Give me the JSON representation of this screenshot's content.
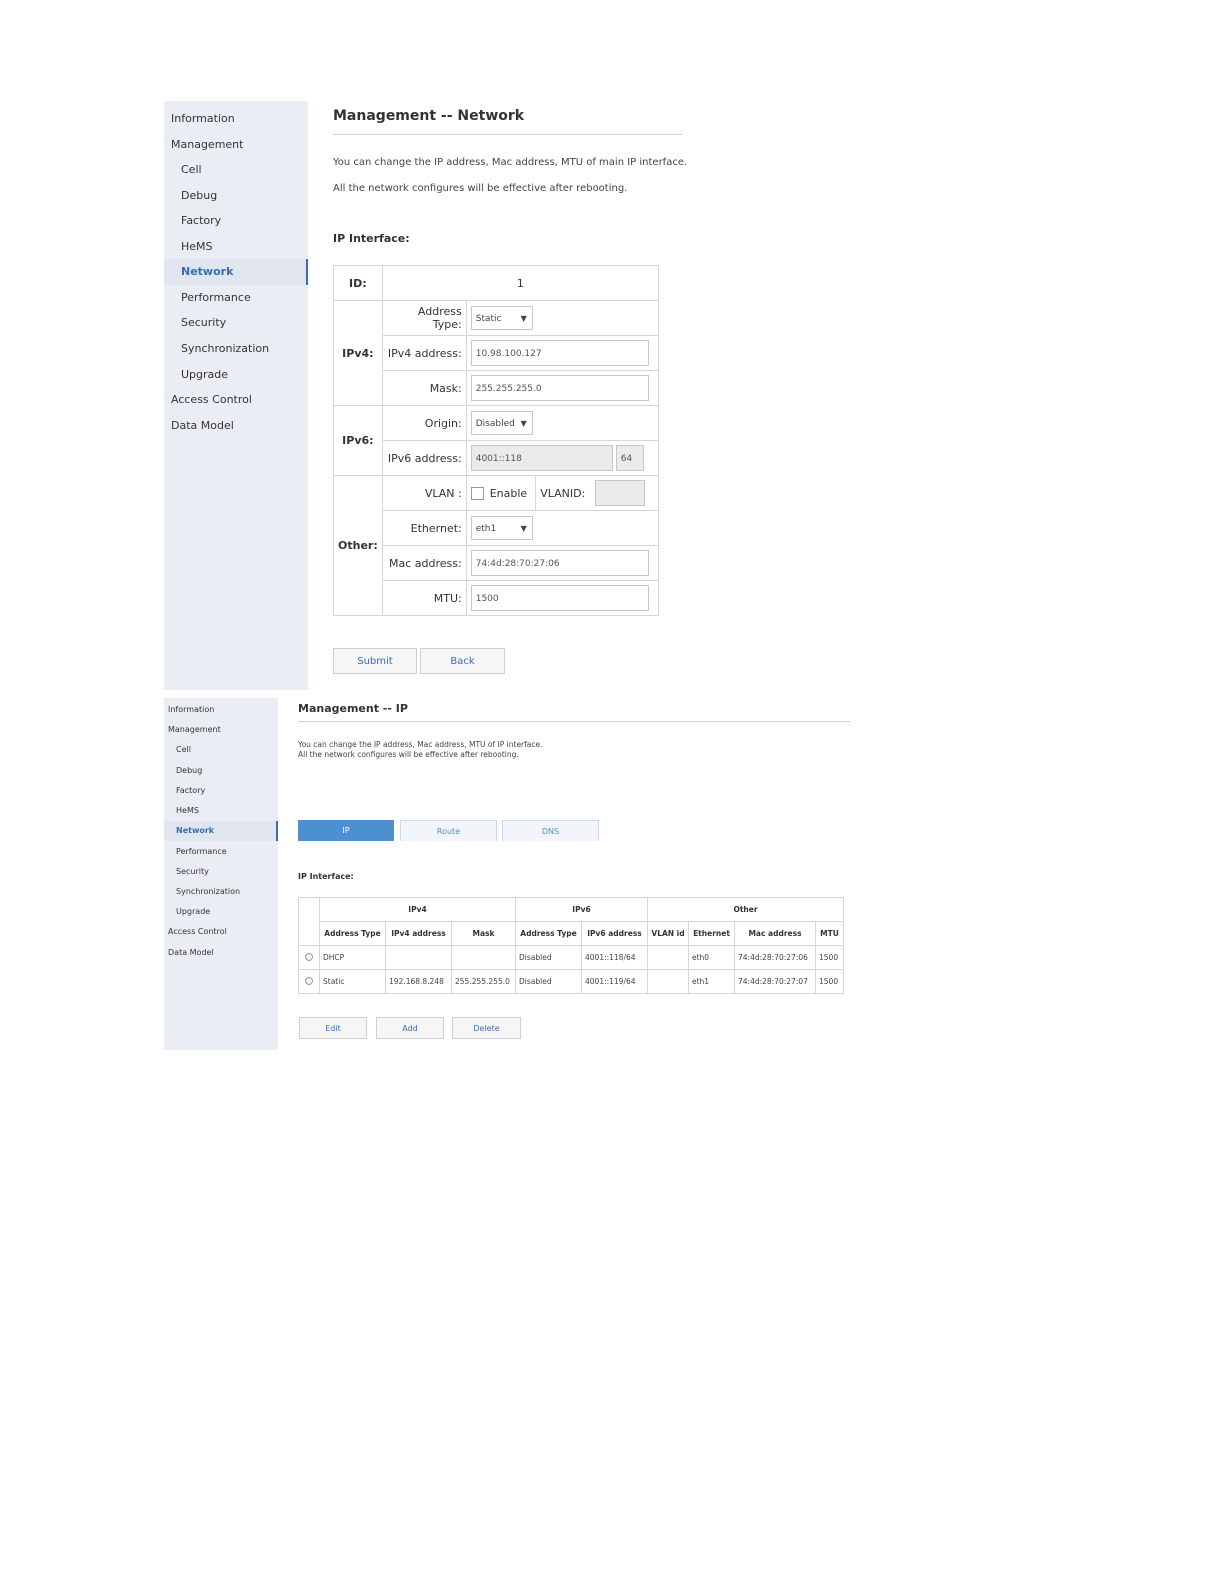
{
  "screen1": {
    "sidebar": {
      "items": [
        {
          "label": "Information"
        },
        {
          "label": "Management"
        },
        {
          "label": "Cell"
        },
        {
          "label": "Debug"
        },
        {
          "label": "Factory"
        },
        {
          "label": "HeMS"
        },
        {
          "label": "Network"
        },
        {
          "label": "Performance"
        },
        {
          "label": "Security"
        },
        {
          "label": "Synchronization"
        },
        {
          "label": "Upgrade"
        },
        {
          "label": "Access Control"
        },
        {
          "label": "Data Model"
        }
      ]
    },
    "title": "Management -- Network",
    "desc_line1": "You can change the IP address, Mac address, MTU of main IP interface.",
    "desc_line2": "All the network configures will be effective after rebooting.",
    "section_title": "IP Interface:",
    "form": {
      "id_label": "ID:",
      "id_value": "1",
      "ipv4_group": "IPv4:",
      "address_type_label": "Address Type:",
      "address_type_value": "Static",
      "ipv4_address_label": "IPv4 address:",
      "ipv4_address_value": "10.98.100.127",
      "mask_label": "Mask:",
      "mask_value": "255.255.255.0",
      "ipv6_group": "IPv6:",
      "origin_label": "Origin:",
      "origin_value": "Disabled",
      "ipv6_address_label": "IPv6 address:",
      "ipv6_address_value": "4001::118",
      "ipv6_prefix_value": "64",
      "other_group": "Other:",
      "vlan_label": "VLAN :",
      "vlan_enable_label": "Enable",
      "vlanid_label": "VLANID:",
      "vlanid_value": "",
      "ethernet_label": "Ethernet:",
      "ethernet_value": "eth1",
      "mac_label": "Mac address:",
      "mac_value": "74:4d:28:70:27:06",
      "mtu_label": "MTU:",
      "mtu_value": "1500"
    },
    "buttons": {
      "submit": "Submit",
      "back": "Back"
    },
    "caret": "▼"
  },
  "screen2": {
    "sidebar": {
      "items": [
        {
          "label": "Information"
        },
        {
          "label": "Management"
        },
        {
          "label": "Cell"
        },
        {
          "label": "Debug"
        },
        {
          "label": "Factory"
        },
        {
          "label": "HeMS"
        },
        {
          "label": "Network"
        },
        {
          "label": "Performance"
        },
        {
          "label": "Security"
        },
        {
          "label": "Synchronization"
        },
        {
          "label": "Upgrade"
        },
        {
          "label": "Access Control"
        },
        {
          "label": "Data Model"
        }
      ]
    },
    "title": "Management -- IP",
    "desc_line1": "You can change the IP address, Mac address, MTU of IP interface.",
    "desc_line2": "All the network configures will be effective after rebooting.",
    "tabs": [
      {
        "label": "IP"
      },
      {
        "label": "Route"
      },
      {
        "label": "DNS"
      }
    ],
    "section_title": "IP Interface:",
    "table": {
      "groups": {
        "ipv4": "IPv4",
        "ipv6": "IPv6",
        "other": "Other"
      },
      "columns": [
        "Address Type",
        "IPv4 address",
        "Mask",
        "Address Type",
        "IPv6 address",
        "VLAN id",
        "Ethernet",
        "Mac address",
        "MTU"
      ],
      "rows": [
        [
          "DHCP",
          "",
          "",
          "Disabled",
          "4001::118/64",
          "",
          "eth0",
          "74:4d:28:70:27:06",
          "1500"
        ],
        [
          "Static",
          "192.168.8.248",
          "255.255.255.0",
          "Disabled",
          "4001::119/64",
          "",
          "eth1",
          "74:4d:28:70:27:07",
          "1500"
        ]
      ]
    },
    "buttons": {
      "edit": "Edit",
      "add": "Add",
      "delete": "Delete"
    }
  }
}
